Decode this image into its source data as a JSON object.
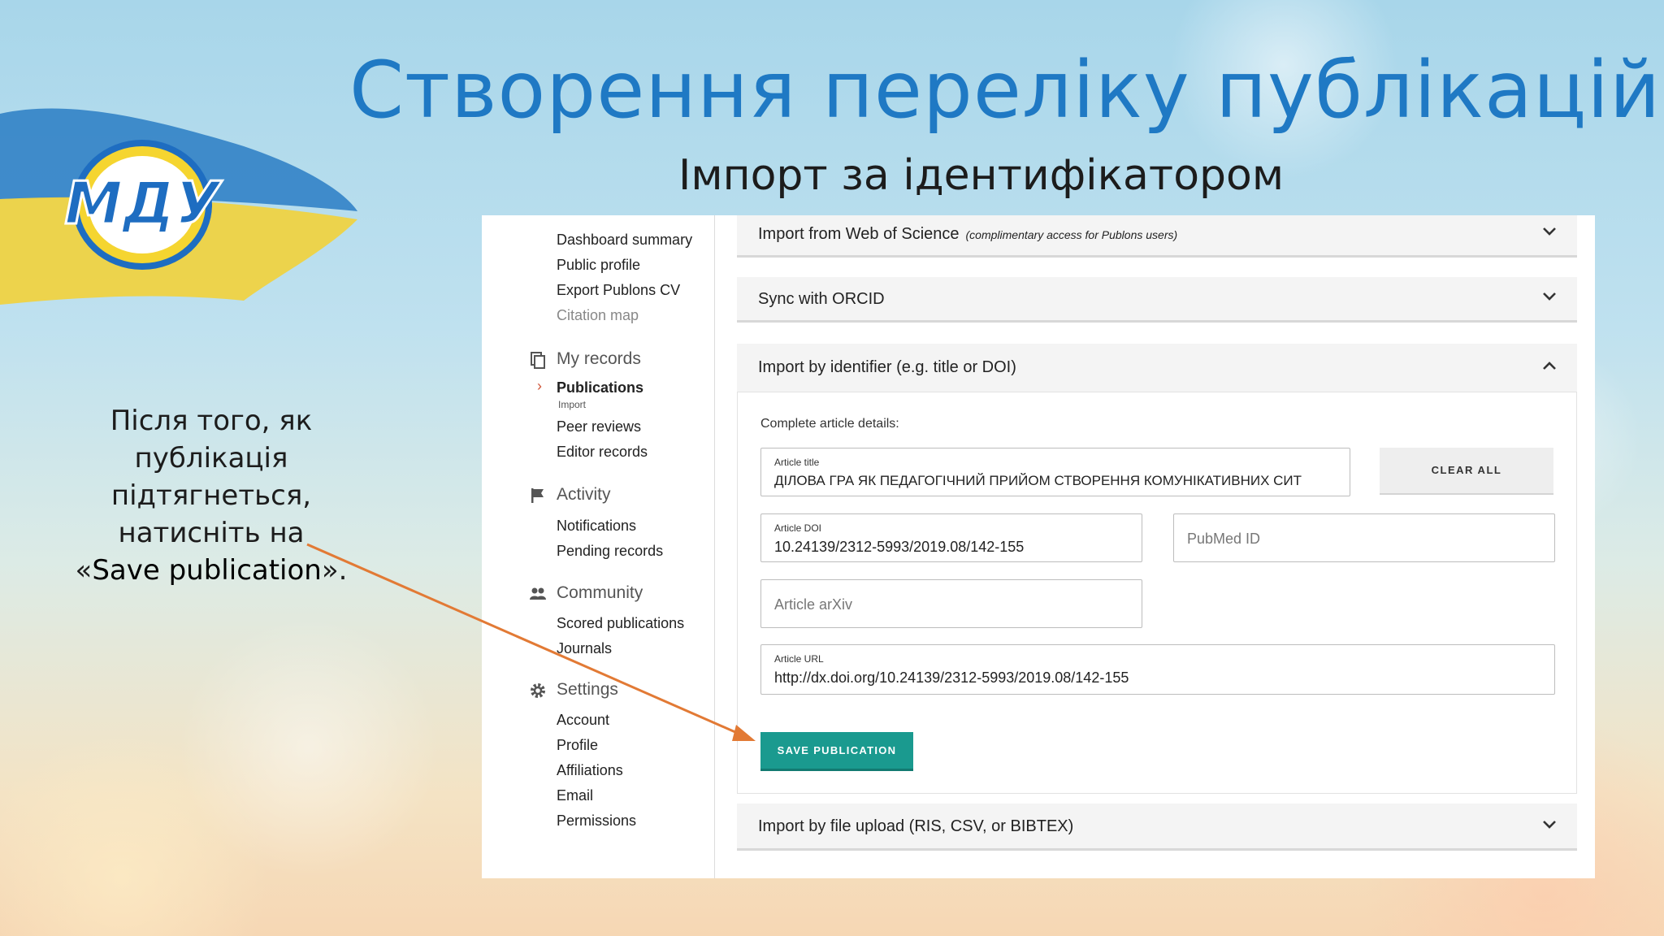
{
  "slide": {
    "title": "Створення переліку публікацій",
    "subtitle": "Імпорт за ідентифікатором",
    "logo_text": "МДУ",
    "note_prefix": "Після того, як публікація підтягнеться, натисніть на «",
    "note_highlight": "Save publication",
    "note_suffix": "».",
    "colors": {
      "title": "#1f79c4",
      "arrow": "#e27a35"
    }
  },
  "sidebar": {
    "me_items": [
      "Dashboard summary",
      "Public profile",
      "Export Publons CV",
      "Citation map"
    ],
    "my_records": {
      "label": "My records",
      "active": "Publications",
      "active_sub": "Import",
      "items": [
        "Peer reviews",
        "Editor records"
      ]
    },
    "activity": {
      "label": "Activity",
      "items": [
        "Notifications",
        "Pending records"
      ]
    },
    "community": {
      "label": "Community",
      "items": [
        "Scored publications",
        "Journals"
      ]
    },
    "settings": {
      "label": "Settings",
      "items": [
        "Account",
        "Profile",
        "Affiliations",
        "Email",
        "Permissions"
      ]
    }
  },
  "accordions": {
    "wos": {
      "title": "Import from Web of Science",
      "note": "(complimentary access for Publons users)"
    },
    "orcid": {
      "title": "Sync with ORCID"
    },
    "identifier": {
      "title": "Import by identifier (e.g. title or DOI)"
    },
    "file": {
      "title": "Import by file upload (RIS, CSV, or BIBTEX)"
    }
  },
  "form": {
    "heading": "Complete article details:",
    "title_label": "Article title",
    "title_value": "ДІЛОВА ГРА ЯК ПЕДАГОГІЧНИЙ ПРИЙОМ СТВОРЕННЯ КОМУНІКАТИВНИХ СИТ",
    "clear_label": "CLEAR ALL",
    "doi_label": "Article DOI",
    "doi_value": "10.24139/2312-5993/2019.08/142-155",
    "pubmed_placeholder": "PubMed ID",
    "arxiv_placeholder": "Article arXiv",
    "url_label": "Article URL",
    "url_value": "http://dx.doi.org/10.24139/2312-5993/2019.08/142-155",
    "save_label": "SAVE PUBLICATION"
  }
}
